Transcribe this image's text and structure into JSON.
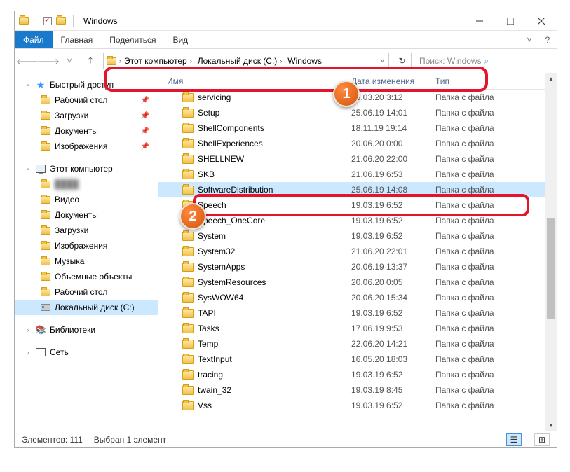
{
  "title": "Windows",
  "ribbon": {
    "file": "Файл",
    "home": "Главная",
    "share": "Поделиться",
    "view": "Вид"
  },
  "breadcrumb": [
    "Этот компьютер",
    "Локальный диск (C:)",
    "Windows"
  ],
  "search": {
    "placeholder": "Поиск: Windows"
  },
  "sidebar": {
    "quick": {
      "label": "Быстрый доступ",
      "items": [
        {
          "label": "Рабочий стол"
        },
        {
          "label": "Загрузки"
        },
        {
          "label": "Документы"
        },
        {
          "label": "Изображения"
        }
      ]
    },
    "pc": {
      "label": "Этот компьютер",
      "items": [
        {
          "label": "",
          "blur": true
        },
        {
          "label": "Видео"
        },
        {
          "label": "Документы"
        },
        {
          "label": "Загрузки"
        },
        {
          "label": "Изображения"
        },
        {
          "label": "Музыка"
        },
        {
          "label": "Объемные объекты"
        },
        {
          "label": "Рабочий стол"
        },
        {
          "label": "Локальный диск (C:)",
          "selected": true
        }
      ]
    },
    "libs": {
      "label": "Библиотеки"
    },
    "net": {
      "label": "Сеть"
    }
  },
  "headers": {
    "name": "Имя",
    "date": "Дата изменения",
    "type": "Тип"
  },
  "type_label": "Папка с файла",
  "rows": [
    {
      "name": "servicing",
      "date": "15.03.20 3:12"
    },
    {
      "name": "Setup",
      "date": "25.06.19 14:01"
    },
    {
      "name": "ShellComponents",
      "date": "18.11.19 19:14"
    },
    {
      "name": "ShellExperiences",
      "date": "20.06.20 0:00"
    },
    {
      "name": "SHELLNEW",
      "date": "21.06.20 22:00"
    },
    {
      "name": "SKB",
      "date": "21.06.19 6:53"
    },
    {
      "name": "SoftwareDistribution",
      "date": "25.06.19 14:08",
      "selected": true
    },
    {
      "name": "Speech",
      "date": "19.03.19 6:52"
    },
    {
      "name": "Speech_OneCore",
      "date": "19.03.19 6:52"
    },
    {
      "name": "System",
      "date": "19.03.19 6:52"
    },
    {
      "name": "System32",
      "date": "21.06.20 22:01"
    },
    {
      "name": "SystemApps",
      "date": "20.06.19 13:37"
    },
    {
      "name": "SystemResources",
      "date": "20.06.20 0:05"
    },
    {
      "name": "SysWOW64",
      "date": "20.06.20 15:34"
    },
    {
      "name": "TAPI",
      "date": "19.03.19 6:52"
    },
    {
      "name": "Tasks",
      "date": "17.06.19 9:53"
    },
    {
      "name": "Temp",
      "date": "22.06.20 14:21"
    },
    {
      "name": "TextInput",
      "date": "16.05.20 18:03"
    },
    {
      "name": "tracing",
      "date": "19.03.19 6:52"
    },
    {
      "name": "twain_32",
      "date": "19.03.19 8:45"
    },
    {
      "name": "Vss",
      "date": "19.03.19 6:52"
    }
  ],
  "status": {
    "count": "Элементов: 111",
    "selected": "Выбран 1 элемент"
  },
  "annotations": {
    "b1": "1",
    "b2": "2"
  }
}
